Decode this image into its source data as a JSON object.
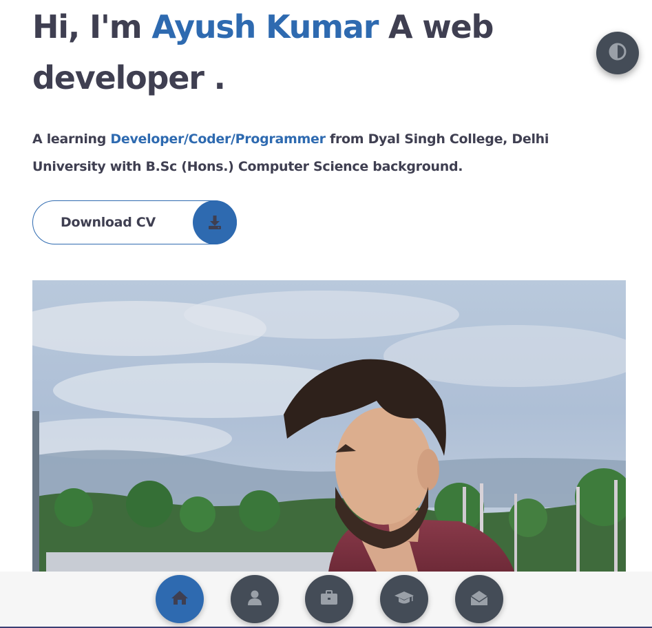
{
  "hero": {
    "greeting": "Hi, I'm ",
    "name": "Ayush Kumar",
    "role_line1": " A web",
    "role_line2": "developer ."
  },
  "description": {
    "prefix": "A learning ",
    "highlight": "Developer/Coder/Programmer",
    "suffix": " from Dyal Singh College, Delhi University with B.Sc (Hons.) Computer Science background."
  },
  "download": {
    "label": "Download CV",
    "icon": "download-icon"
  },
  "theme_toggle": {
    "icon": "contrast-icon"
  },
  "photo": {
    "subject": "portrait-photo"
  },
  "nav": {
    "items": [
      {
        "icon": "home-icon",
        "active": true
      },
      {
        "icon": "user-icon",
        "active": false
      },
      {
        "icon": "briefcase-icon",
        "active": false
      },
      {
        "icon": "graduation-cap-icon",
        "active": false
      },
      {
        "icon": "envelope-open-icon",
        "active": false
      }
    ]
  },
  "colors": {
    "accent": "#2e6ab0",
    "text": "#3f3f51",
    "nav_button": "#444c57",
    "nav_bar": "#f6f6f6"
  }
}
